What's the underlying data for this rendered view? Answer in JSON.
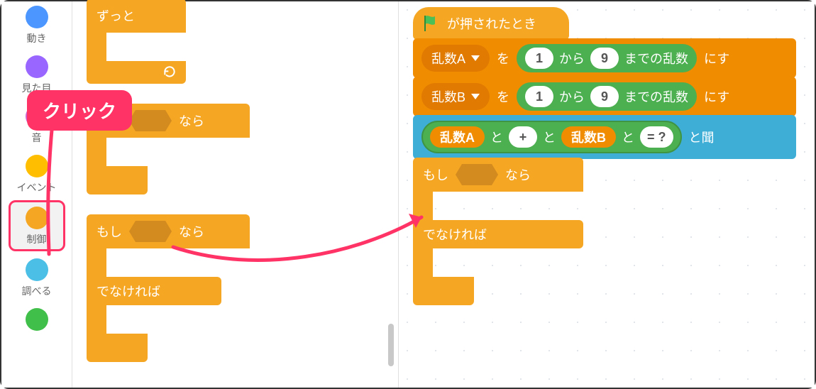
{
  "sidebar": {
    "categories": [
      {
        "label": "動き",
        "color": "#4c97ff"
      },
      {
        "label": "見た目",
        "color": "#9966ff"
      },
      {
        "label": "音",
        "color": "#cf63cf"
      },
      {
        "label": "イベント",
        "color": "#ffbf00"
      },
      {
        "label": "制御",
        "color": "#f5a623",
        "selected": true
      },
      {
        "label": "調べる",
        "color": "#4cbfe6"
      },
      {
        "label": "",
        "color": "#40bf4a"
      }
    ]
  },
  "palette": {
    "forever": "ずっと",
    "if": "もし",
    "then": "なら",
    "else": "でなければ",
    "loop_icon": "↻"
  },
  "workspace": {
    "hat": {
      "flag_color": "#4cbf56",
      "label": "が押されたとき"
    },
    "setA": {
      "var": "乱数A",
      "to": "を",
      "from_val": "1",
      "from_label": "から",
      "to_val": "9",
      "to_label": "までの乱数",
      "trail": "にす"
    },
    "setB": {
      "var": "乱数B",
      "to": "を",
      "from_val": "1",
      "from_label": "から",
      "to_val": "9",
      "to_label": "までの乱数",
      "trail": "にす"
    },
    "ask": {
      "varA": "乱数A",
      "and1": "と",
      "plus": "+",
      "and2": "と",
      "varB": "乱数B",
      "and3": "と",
      "eq": "= ?",
      "trail": "と聞"
    },
    "if": "もし",
    "then": "なら",
    "else": "でなければ"
  },
  "annotation": {
    "click": "クリック"
  }
}
